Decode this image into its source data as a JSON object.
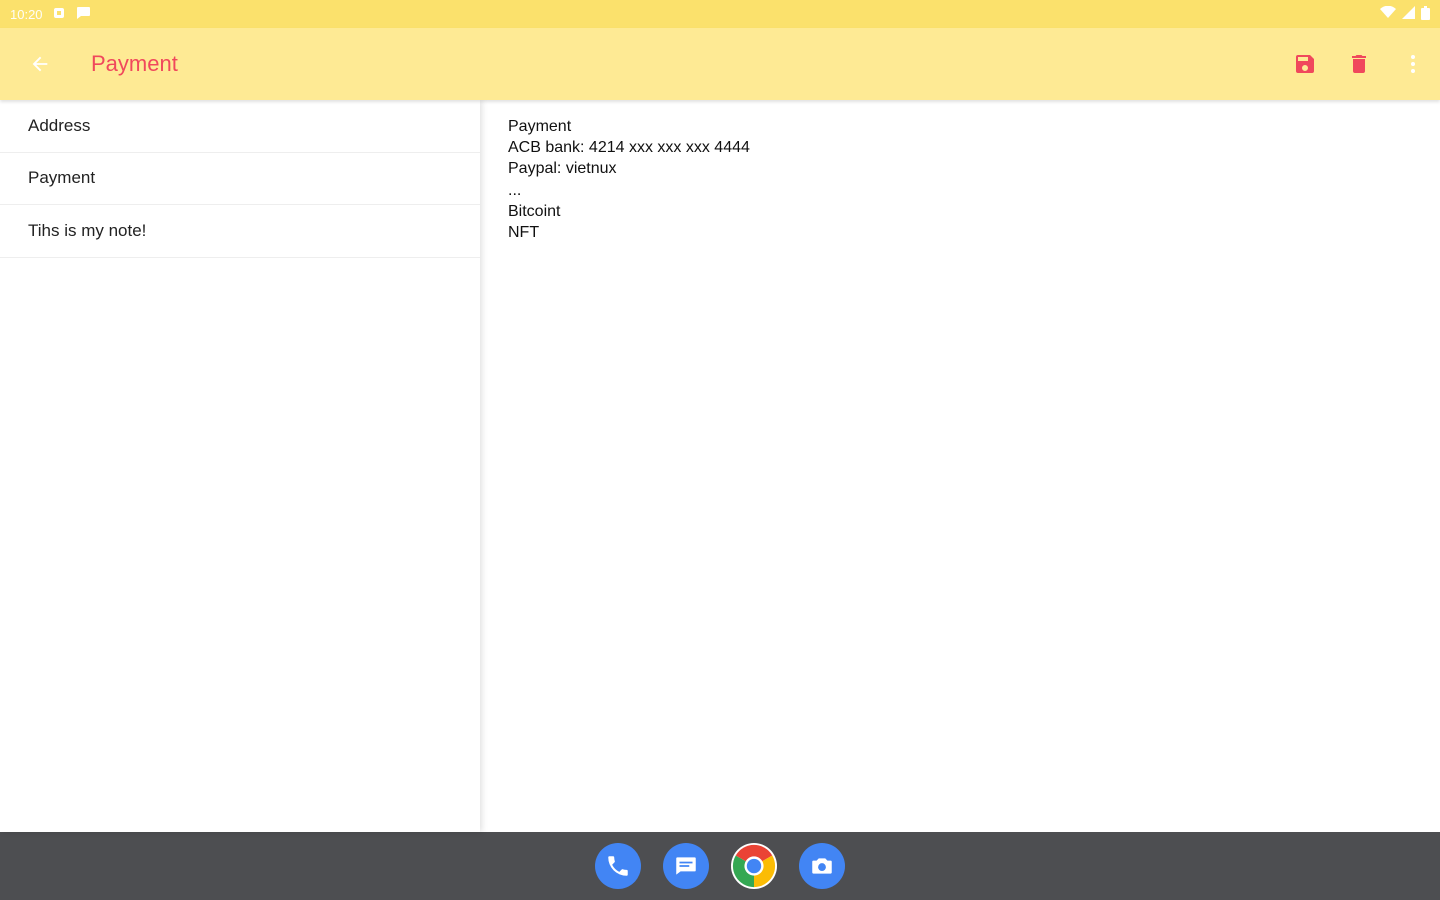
{
  "status_bar": {
    "time": "10:20",
    "icons": [
      "notification-icon",
      "chat-icon",
      "wifi-icon",
      "signal-icon",
      "battery-icon"
    ]
  },
  "app_bar": {
    "title": "Payment",
    "actions": [
      "save-icon",
      "delete-icon",
      "more-vert-icon"
    ]
  },
  "colors": {
    "status_bar": "#fbe16c",
    "app_bar": "#feea94",
    "accent": "#f0485c",
    "nav_bar": "#4d4e51",
    "dock_blue": "#4285f4"
  },
  "notes_list": {
    "items": [
      {
        "title": "Address"
      },
      {
        "title": "Payment"
      },
      {
        "title": "Tihs is my note!"
      }
    ]
  },
  "note_content": {
    "lines": [
      "Payment",
      "ACB bank: 4214 xxx xxx xxx 4444",
      "Paypal: vietnux",
      "...",
      "Bitcoint",
      "NFT"
    ]
  },
  "dock": {
    "apps": [
      "phone-icon",
      "messages-icon",
      "chrome-icon",
      "camera-icon"
    ]
  }
}
